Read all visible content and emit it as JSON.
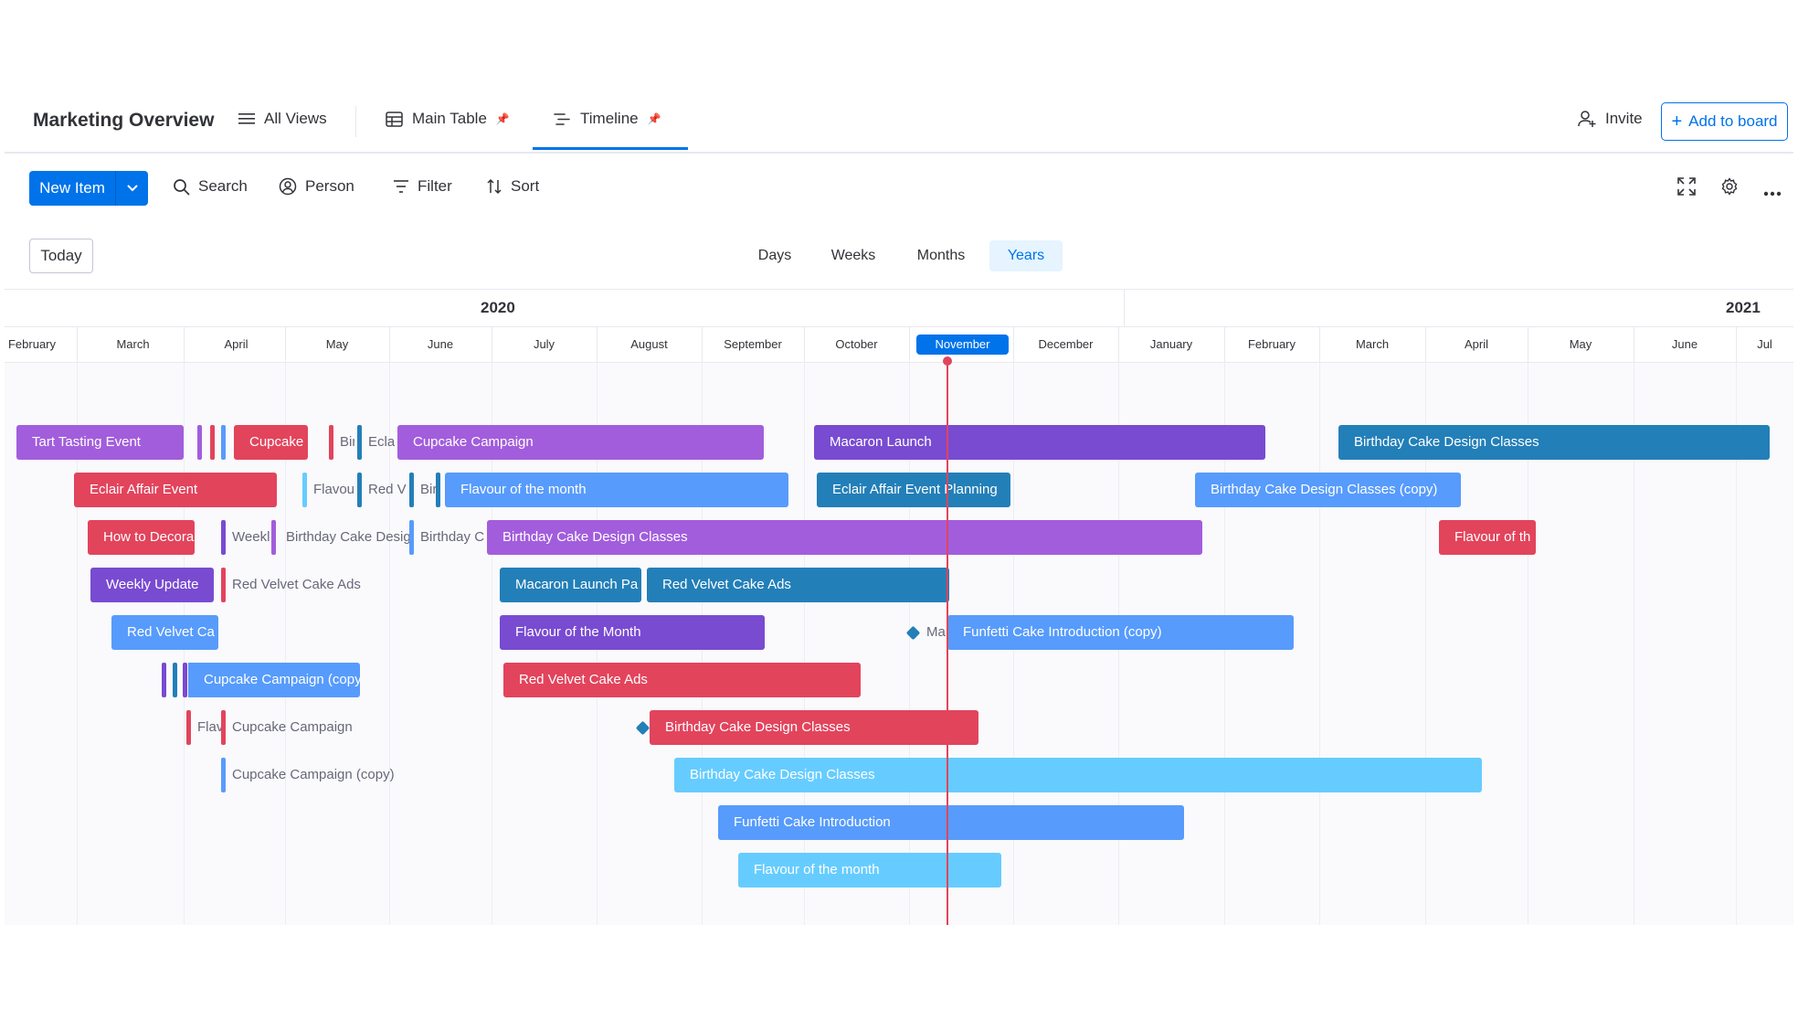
{
  "header": {
    "board_title": "Marketing Overview",
    "all_views": "All Views",
    "tabs": [
      {
        "label": "Main Table",
        "icon": "table-icon"
      },
      {
        "label": "Timeline",
        "icon": "timeline-icon"
      }
    ],
    "invite": "Invite",
    "add_to_board": "Add to board"
  },
  "toolbar": {
    "new_item": "New Item",
    "search": "Search",
    "person": "Person",
    "filter": "Filter",
    "sort": "Sort"
  },
  "zoom": {
    "today": "Today",
    "options": [
      "Days",
      "Weeks",
      "Months",
      "Years"
    ],
    "selected": "Years"
  },
  "timeline": {
    "years": [
      "2020",
      "2021"
    ],
    "months": [
      "February",
      "March",
      "April",
      "May",
      "June",
      "July",
      "August",
      "September",
      "October",
      "November",
      "December",
      "January",
      "February",
      "March",
      "April",
      "May",
      "June",
      "Jul"
    ],
    "current_month": "November",
    "items": {
      "tart_tasting_event": "Tart Tasting Event",
      "cupcake_a": "Cupcake",
      "bir_a": "Bir",
      "eclai_a": "Eclai",
      "cupcake_campaign": "Cupcake Campaign",
      "macaron_launch": "Macaron Launch",
      "birthday_cake_design_classes_2021": "Birthday Cake Design Classes",
      "eclair_affair_event": "Eclair Affair Event",
      "flavou_a": "Flavou",
      "red_v_a": "Red V",
      "bir_b": "Bir",
      "flavour_of_the_month_a": "Flavour of the month",
      "eclair_affair_event_planning": "Eclair Affair Event Planning",
      "birthday_cake_design_classes_copy": "Birthday Cake Design Classes (copy)",
      "how_to_decora": "How to Decora",
      "weekl_a": "Weekl",
      "birthday_cake_desig_a": "Birthday Cake Desig",
      "birthday_c_a": "Birthday C",
      "birthday_cake_design_classes_purple": "Birthday Cake Design Classes",
      "flavour_of_th_2021": "Flavour of th",
      "weekly_update": "Weekly Update",
      "red_velvet_cake_ads_ext": "Red Velvet Cake Ads",
      "macaron_launch_pa": "Macaron Launch Pa",
      "red_velvet_cake_ads_teal": "Red Velvet Cake Ads",
      "red_velvet_ca": "Red Velvet Ca",
      "flavour_of_the_month_b": "Flavour of the Month",
      "ma_ext": "Ma",
      "funfetti_cake_introduction_copy": "Funfetti Cake Introduction (copy)",
      "cupcake_campaign_copy_bar": "Cupcake Campaign (copy)",
      "red_velvet_cake_ads_pink": "Red Velvet Cake Ads",
      "flav_ext": "Flav",
      "cupcake_campaign_ext": "Cupcake Campaign",
      "birthday_cake_design_classes_pink": "Birthday Cake Design Classes",
      "cupcake_campaign_copy_ext": "Cupcake Campaign (copy)",
      "birthday_cake_design_classes_light": "Birthday Cake Design Classes",
      "funfetti_cake_introduction": "Funfetti Cake Introduction",
      "flavour_of_the_month_light": "Flavour of the month"
    }
  },
  "colors": {
    "primary": "#0073ea",
    "purple": "#a25ddc",
    "dark_purple": "#784bd1",
    "pink": "#e2445c",
    "magenta": "#ff158a",
    "blue": "#579bfc",
    "teal": "#237fb8",
    "light_blue": "#66ccff",
    "today_line": "#e2445c"
  }
}
